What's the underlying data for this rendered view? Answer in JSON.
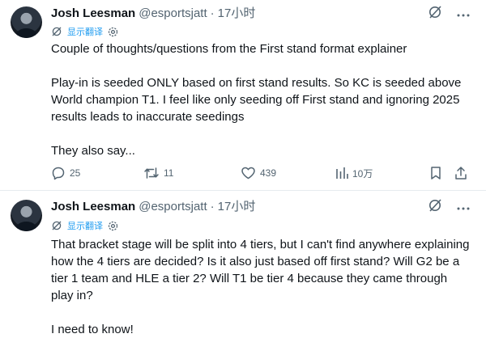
{
  "tweets": [
    {
      "author": "Josh Leesman",
      "handle": "@esportsjatt",
      "separator": "·",
      "time": "17小时",
      "translate_label": "显示翻译",
      "paragraphs": [
        "Couple of thoughts/questions from the First stand format explainer",
        "Play-in is seeded ONLY based on first stand results. So KC is seeded above World champion T1. I feel like only seeding off First stand and ignoring 2025 results leads to inaccurate seedings",
        "They also say..."
      ],
      "actions": {
        "replies": "25",
        "retweets": "11",
        "likes": "439",
        "views": "10万"
      }
    },
    {
      "author": "Josh Leesman",
      "handle": "@esportsjatt",
      "separator": "·",
      "time": "17小时",
      "translate_label": "显示翻译",
      "paragraphs": [
        "That bracket stage will be split into 4 tiers, but I can't find anywhere explaining how the 4 tiers are decided? Is it also just based off first stand? Will G2 be a tier 1 team and HLE a tier 2? Will T1 be tier 4 because they came through play in?",
        "I need to know!"
      ]
    }
  ],
  "icons": {
    "grok": "grok-icon",
    "more": "more-icon",
    "translate": "translate-icon",
    "settings": "settings-icon",
    "reply": "reply-icon",
    "retweet": "retweet-icon",
    "like": "like-icon",
    "views": "views-icon",
    "bookmark": "bookmark-icon",
    "share": "share-icon"
  },
  "colors": {
    "text": "#0f1419",
    "secondary": "#536471",
    "link": "#1d9bf0",
    "divider": "#e6ebef"
  }
}
